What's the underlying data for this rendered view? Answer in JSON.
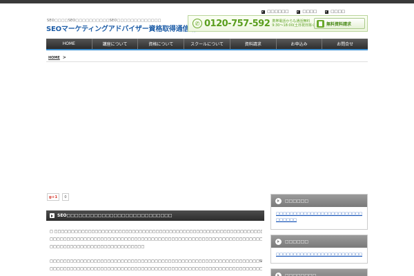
{
  "top_links": [
    {
      "label": "□□□□□□"
    },
    {
      "label": "□□□□"
    },
    {
      "label": "□□□□"
    }
  ],
  "header": {
    "tagline": "SEO□□□□SEO□□□□□□□□□□SEO□□□□□□□□□□□□□",
    "site_title": "SEOマーケティングアドバイザー資格取得通信講座"
  },
  "contact": {
    "phone_icon": "phone-icon",
    "phone_number": "0120-757-592",
    "note_line1": "携帯電話からも通話無料",
    "note_line2": "9:30〜18:00(土日祝日除く)",
    "brochure_label": "無料資料請求"
  },
  "nav": {
    "items": [
      {
        "label": "HOME"
      },
      {
        "label": "講座について"
      },
      {
        "label": "資格について"
      },
      {
        "label": "スクールについて"
      },
      {
        "label": "資料請求"
      },
      {
        "label": "お申込み"
      },
      {
        "label": "お問合せ"
      }
    ]
  },
  "breadcrumb": {
    "home": "HOME",
    "separator": ">"
  },
  "social": {
    "gplus_label": "g+1",
    "gplus_count": "0"
  },
  "main": {
    "section_title": "SEO□□□□□□□□□□□□□□□□□□□□□□□□□□□",
    "paragraphs": [
      "□ □□□□□□□□□□□□□□□□□□□□□□□□□□□□□□□□□□□□□□□□□□□□□□□□□□□□□□□□□□□□□□□□□□□□□□□□□□□□□□ □□□□ □",
      "□□□□□□□□□□□□□□□□□□□□□□□□□□□□□□□□□□□□□□□□□□□□□□□□□□□□□□□□□□□□□□□□□□□□□□□□□□□□□□□□□□□□□□",
      "□□□□□□□□□□□□□□□□□□□□□□□□□□□□",
      "□□□□□□□□□□□□□□□□□□□□□□□□□□□□□□□□□□□□□□□□□□□□□□□□□□□□□□□□□□□□□□SEO□□□□□□□□□□□",
      "□□□□□□□□□□□□□□□□□□□□□□□□□□□□□□□□□□□□□□□□□□□□□□□□□□□□□□□□□□□□□□□□□□□□□□□□□□□□□□□□□□□□□□"
    ]
  },
  "sidebar": {
    "widgets": [
      {
        "title": "□□□□□□",
        "links": [
          "□□□□□□□□□□□□□□□□□□□□□□□□□□□□□□□□□",
          "□□□□□□"
        ]
      },
      {
        "title": "□□□□□□",
        "links": [
          "□□□□□□□□□□□□□□□□□□□□□□□□□□□□□□"
        ]
      },
      {
        "title": "□□□□□□□□",
        "links": []
      }
    ]
  }
}
